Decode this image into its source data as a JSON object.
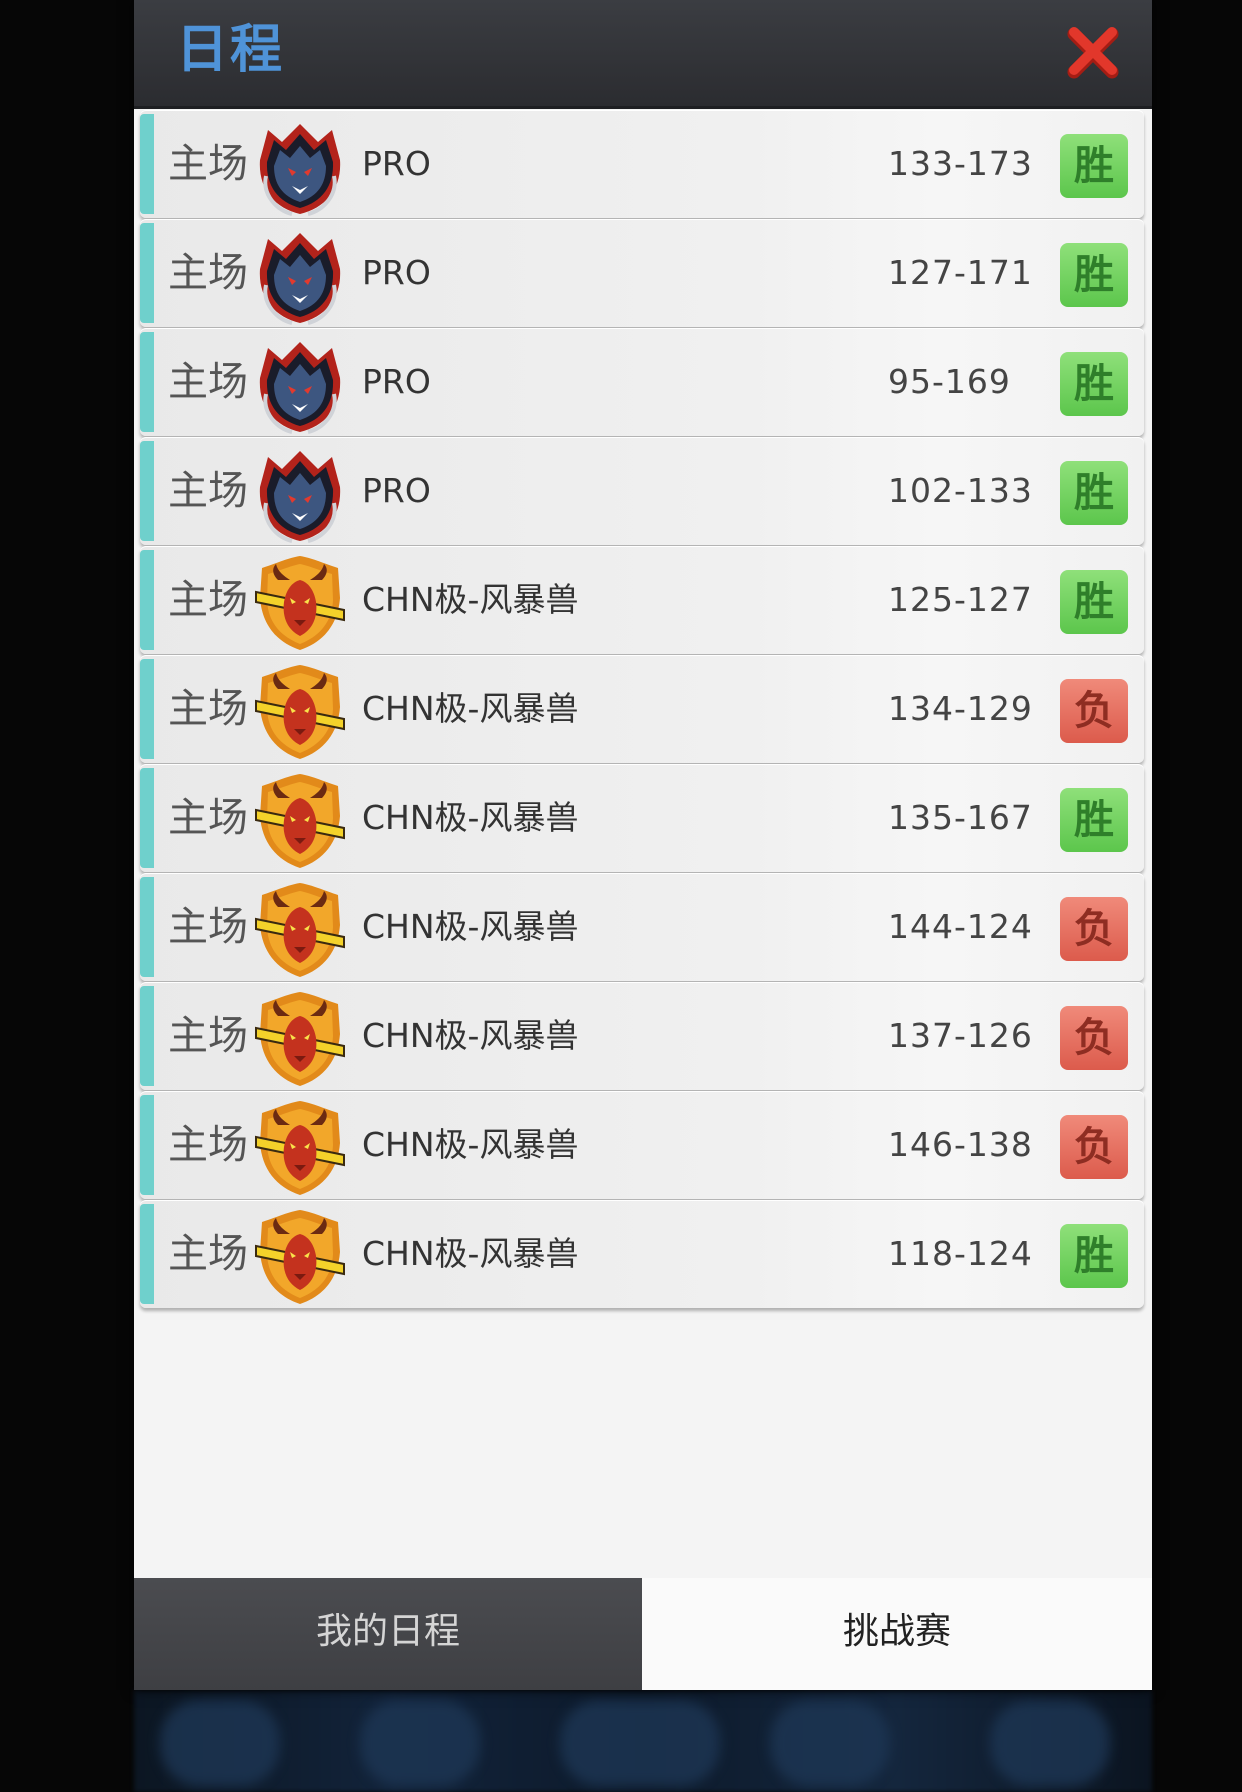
{
  "window": {
    "title": "日程",
    "close_icon": "close-x-icon",
    "accent_title_color": "#4f93d8",
    "close_color": "#e2372b"
  },
  "schedule": {
    "rows": [
      {
        "venue": "主场",
        "team": "PRO",
        "logo": "wolf-logo",
        "score": "133-173",
        "result": "胜",
        "result_type": "win"
      },
      {
        "venue": "主场",
        "team": "PRO",
        "logo": "wolf-logo",
        "score": "127-171",
        "result": "胜",
        "result_type": "win"
      },
      {
        "venue": "主场",
        "team": "PRO",
        "logo": "wolf-logo",
        "score": "95-169",
        "result": "胜",
        "result_type": "win"
      },
      {
        "venue": "主场",
        "team": "PRO",
        "logo": "wolf-logo",
        "score": "102-133",
        "result": "胜",
        "result_type": "win"
      },
      {
        "venue": "主场",
        "team": "CHN极-风暴兽",
        "logo": "bull-logo",
        "score": "125-127",
        "result": "胜",
        "result_type": "win"
      },
      {
        "venue": "主场",
        "team": "CHN极-风暴兽",
        "logo": "bull-logo",
        "score": "134-129",
        "result": "负",
        "result_type": "loss"
      },
      {
        "venue": "主场",
        "team": "CHN极-风暴兽",
        "logo": "bull-logo",
        "score": "135-167",
        "result": "胜",
        "result_type": "win"
      },
      {
        "venue": "主场",
        "team": "CHN极-风暴兽",
        "logo": "bull-logo",
        "score": "144-124",
        "result": "负",
        "result_type": "loss"
      },
      {
        "venue": "主场",
        "team": "CHN极-风暴兽",
        "logo": "bull-logo",
        "score": "137-126",
        "result": "负",
        "result_type": "loss"
      },
      {
        "venue": "主场",
        "team": "CHN极-风暴兽",
        "logo": "bull-logo",
        "score": "146-138",
        "result": "负",
        "result_type": "loss"
      },
      {
        "venue": "主场",
        "team": "CHN极-风暴兽",
        "logo": "bull-logo",
        "score": "118-124",
        "result": "胜",
        "result_type": "win"
      }
    ]
  },
  "tabs": {
    "my_schedule": "我的日程",
    "challenge": "挑战赛",
    "selected": "challenge"
  },
  "colors": {
    "win": "#5cc64c",
    "loss": "#dc5b4c",
    "row_stripe": "#6fd0cc"
  }
}
